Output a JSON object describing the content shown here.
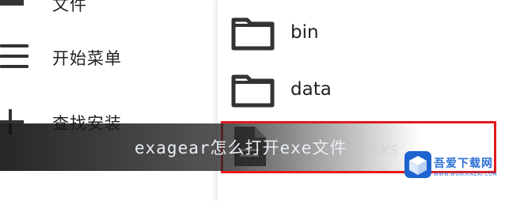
{
  "drawer": {
    "items": [
      {
        "label": "文件",
        "icon": "folder-icon"
      },
      {
        "label": "开始菜单",
        "icon": "menu-icon"
      },
      {
        "label": "查找安装",
        "icon": "plus-icon"
      }
    ]
  },
  "file_list": {
    "items": [
      {
        "name": "bin",
        "icon": "folder-icon"
      },
      {
        "name": "data",
        "icon": "folder-icon"
      },
      {
        "name": "",
        "icon": "document-icon",
        "selected": true
      }
    ]
  },
  "overlay": {
    "caption": "exagear怎么打开exe文件",
    "ghost_text": "cks"
  },
  "watermark": {
    "title": "吾爱下载网",
    "url": "WWW.WUAIXIAZAI.COM"
  },
  "colors": {
    "highlight": "#e31b1b",
    "icon_dark": "#333333",
    "watermark_blue": "#2b6fd6"
  }
}
